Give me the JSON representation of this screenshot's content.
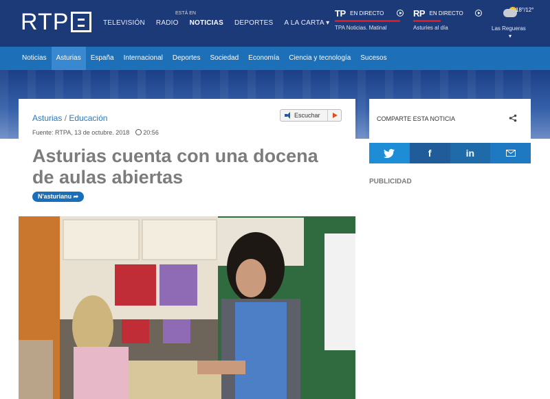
{
  "header": {
    "logo": "RTP",
    "nav": [
      "TELEVISIÓN",
      "RADIO",
      "NOTICIAS",
      "DEPORTES",
      "A LA CARTA"
    ],
    "nav_prefix": "ESTÁ EN",
    "live_tv": {
      "brand": "TP",
      "label": "EN DIRECTO",
      "program": "TPA Noticias. Matinal"
    },
    "live_radio": {
      "brand": "RP",
      "label": "EN DIRECTO",
      "program": "Asturies al día"
    },
    "weather": {
      "temp": "18°/12°",
      "place": "Las Regueras"
    }
  },
  "section_nav": [
    "Noticias",
    "Asturias",
    "España",
    "Internacional",
    "Deportes",
    "Sociedad",
    "Economía",
    "Ciencia y tecnología",
    "Sucesos"
  ],
  "article": {
    "crumb_a": "Asturias",
    "crumb_b": "Educación",
    "source": "Fuente: RTPA, 13 de octubre. 2018",
    "time": "20:56",
    "listen": "Escuchar",
    "title": "Asturias cuenta con una docena de aulas abiertas",
    "lang_button": "N'asturianu ➦"
  },
  "sidebar": {
    "share_label": "COMPARTE ESTA NOTICIA",
    "ad_label": "PUBLICIDAD"
  }
}
